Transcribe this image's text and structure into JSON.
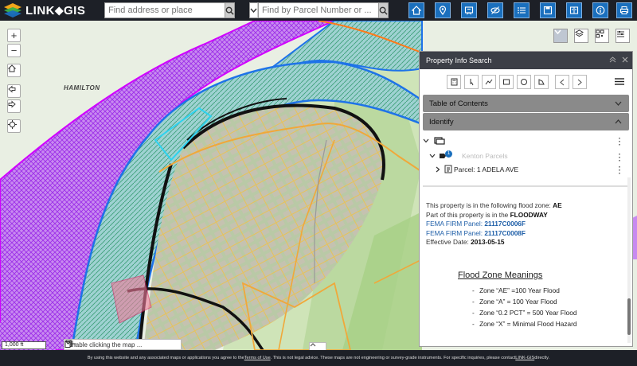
{
  "app": {
    "logo_text": "LINK⬥GIS"
  },
  "search": {
    "address_placeholder": "Find address or place",
    "parcel_placeholder": "Find by Parcel Number or ..."
  },
  "toolbar": {
    "icons": [
      "home-icon",
      "location-pin-icon",
      "parcel-map-icon",
      "layers-eye-icon",
      "list-icon",
      "save-icon",
      "compare-icon",
      "info-icon",
      "print-icon"
    ]
  },
  "map": {
    "place_label": "HAMILTON",
    "scale_label": "1,000 ft",
    "enable_text": "Enable clicking the map ...",
    "zoom_in": "+",
    "zoom_out": "−"
  },
  "panel": {
    "title": "Property Info Search",
    "sections": {
      "toc": "Table of Contents",
      "identify": "Identify"
    },
    "tree": {
      "layer_name": "Kenton Parcels",
      "badge": "1",
      "parcel_label": "Parcel: 1 ADELA AVE"
    },
    "info": {
      "line1_prefix": "This property is in the following flood zone: ",
      "line1_zone": "AE",
      "line2_prefix": "Part of this property is in the ",
      "line2_value": "FLOODWAY",
      "panel1_label": "FEMA FIRM Panel: ",
      "panel1_value": "21117C0006F",
      "panel2_label": "FEMA FIRM Panel: ",
      "panel2_value": "21117C0008F",
      "effective_label": "Effective Date: ",
      "effective_value": "2013-05-15"
    },
    "flood_meanings": {
      "title": "Flood Zone Meanings",
      "items": [
        "Zone “AE” =100 Year Flood",
        "Zone “A” = 100 Year Flood",
        "Zone “0.2 PCT” = 500 Year Flood",
        "Zone “X” = Minimal Flood Hazard"
      ]
    }
  },
  "footer": {
    "text_a": "By using this website and any associated maps or applications you agree to the ",
    "terms_link": "Terms of Use",
    "text_b": ". This is not legal advice. These maps are not engineering or survey-grade instruments. For specific inquiries, please contact ",
    "contact_link": "LINK-GIS",
    "text_c": " directly."
  },
  "colors": {
    "topbar": "#1d2027",
    "toolbar_button": "#1a6fbd",
    "floodway_hatch": "#a020f0",
    "flood_zone_outline": "#1e73e8",
    "section_header": "#8a8a8a"
  }
}
